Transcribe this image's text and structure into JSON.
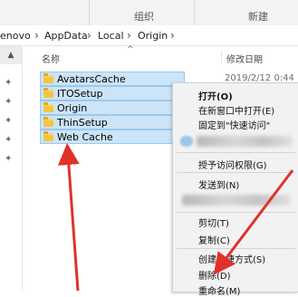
{
  "ribbon": {
    "group_label": "组织",
    "new_label": "新建"
  },
  "address": {
    "crumbs": [
      "enovo",
      "AppData",
      "Local",
      "Origin"
    ],
    "separator": "›"
  },
  "columns": {
    "name": "名称",
    "modified": "修改日期"
  },
  "files": [
    {
      "name": "AvatarsCache",
      "modified": "2019/2/12 0:44"
    },
    {
      "name": "ITOSetup"
    },
    {
      "name": "Origin"
    },
    {
      "name": "ThinSetup"
    },
    {
      "name": "Web Cache"
    }
  ],
  "context_menu": {
    "items": [
      "打开(O)",
      "在新窗口中打开(E)",
      "固定到\"快速访问\"",
      "授予访问权限(G)",
      "发送到(N)",
      "剪切(T)",
      "复制(C)",
      "创建快捷方式(S)",
      "删除(D)",
      "重命名(M)"
    ]
  },
  "icons": {
    "folder": "folder-icon",
    "pin": "pin-icon",
    "chevron": "chevron-up-icon"
  },
  "colors": {
    "selection_bg": "#cce4f7",
    "selection_border": "#99c9ef",
    "arrow_red": "#e0312b",
    "menu_bg": "#f2f2f2"
  }
}
